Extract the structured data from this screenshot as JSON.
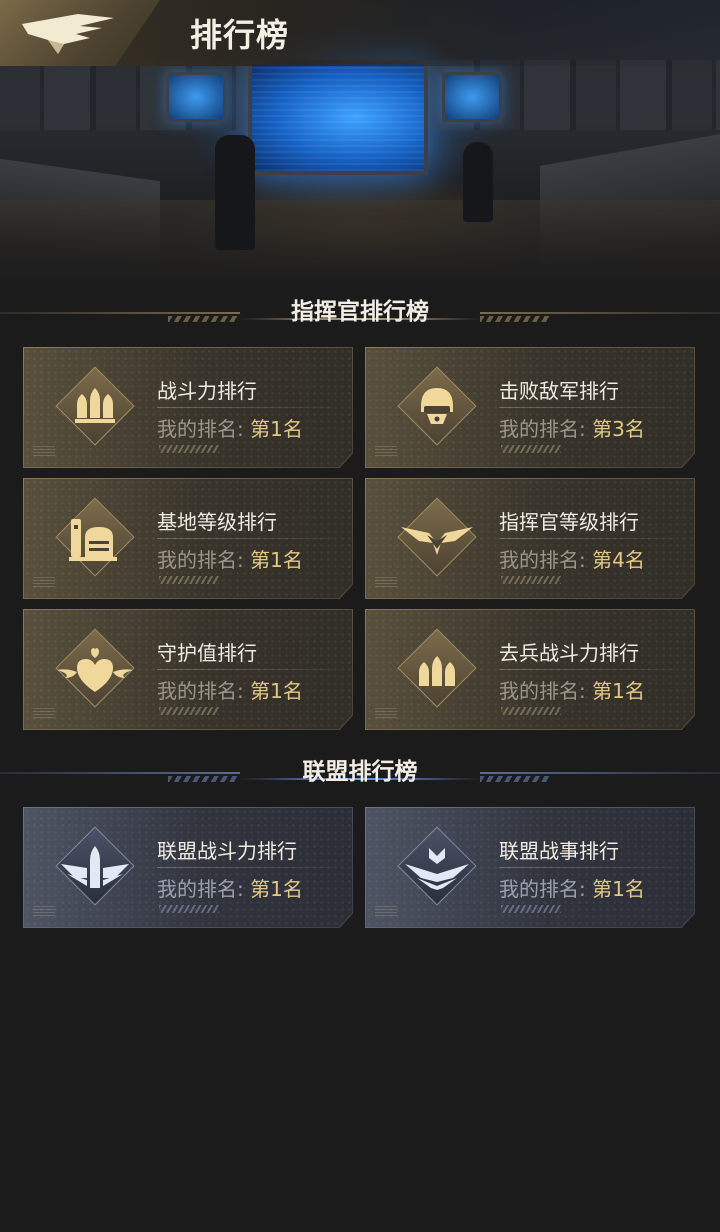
{
  "header": {
    "title": "排行榜"
  },
  "sections": [
    {
      "title": "指挥官排行榜",
      "theme": "gold"
    },
    {
      "title": "联盟排行榜",
      "theme": "blue"
    }
  ],
  "rank_label": "我的排名: ",
  "colors": {
    "gold_accent": "#e3c885",
    "blue_accent": "#6aa0ff",
    "background": "#1b1b1c"
  },
  "commander_cards": [
    {
      "name": "战斗力排行",
      "rank": "第1名",
      "icon": "bullets-icon"
    },
    {
      "name": "击败敌军排行",
      "rank": "第3名",
      "icon": "soldier-helmet-icon"
    },
    {
      "name": "基地等级排行",
      "rank": "第1名",
      "icon": "base-building-icon"
    },
    {
      "name": "指挥官等级排行",
      "rank": "第4名",
      "icon": "commander-wings-icon"
    },
    {
      "name": "守护值排行",
      "rank": "第1名",
      "icon": "winged-heart-icon"
    },
    {
      "name": "去兵战斗力排行",
      "rank": "第1名",
      "icon": "bullets-icon"
    }
  ],
  "alliance_cards": [
    {
      "name": "联盟战斗力排行",
      "rank": "第1名",
      "icon": "winged-bullet-icon"
    },
    {
      "name": "联盟战事排行",
      "rank": "第1名",
      "icon": "alliance-emblem-icon"
    }
  ]
}
